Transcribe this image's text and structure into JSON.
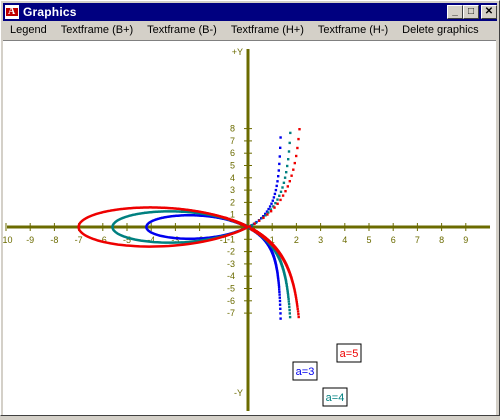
{
  "window": {
    "title": "Graphics",
    "controls": {
      "minimize": "_",
      "maximize": "□",
      "close": "✕"
    }
  },
  "menu": [
    "Legend",
    "Textframe (B+)",
    "Textframe (B-)",
    "Textframe (H+)",
    "Textframe (H-)",
    "Delete graphics"
  ],
  "colors": {
    "axis": "#6b6b00",
    "titlebar": "#000080",
    "a3": "#0000ee",
    "a4": "#008080",
    "a5": "#ee0000"
  },
  "chart_data": {
    "type": "line",
    "x_axis": {
      "label": "",
      "range": [
        -10,
        9.5
      ],
      "ticks": [
        -10,
        -9,
        -8,
        -7,
        -6,
        -5,
        -4,
        -3,
        -2,
        -1,
        1,
        2,
        3,
        4,
        5,
        6,
        7,
        8,
        9
      ]
    },
    "y_axis": {
      "label_top": "+Y",
      "label_bottom": "-Y",
      "range": [
        -7.5,
        8
      ],
      "ticks": [
        8,
        7,
        6,
        5,
        4,
        3,
        2,
        1,
        -1,
        -2,
        -3,
        -4,
        -5,
        -6,
        -7
      ]
    },
    "series": [
      {
        "name": "a=3",
        "a": 3,
        "color": "#0000ee"
      },
      {
        "name": "a=4",
        "a": 4,
        "color": "#008080"
      },
      {
        "name": "a=5",
        "a": 5,
        "color": "#ee0000"
      }
    ],
    "grid": false
  }
}
